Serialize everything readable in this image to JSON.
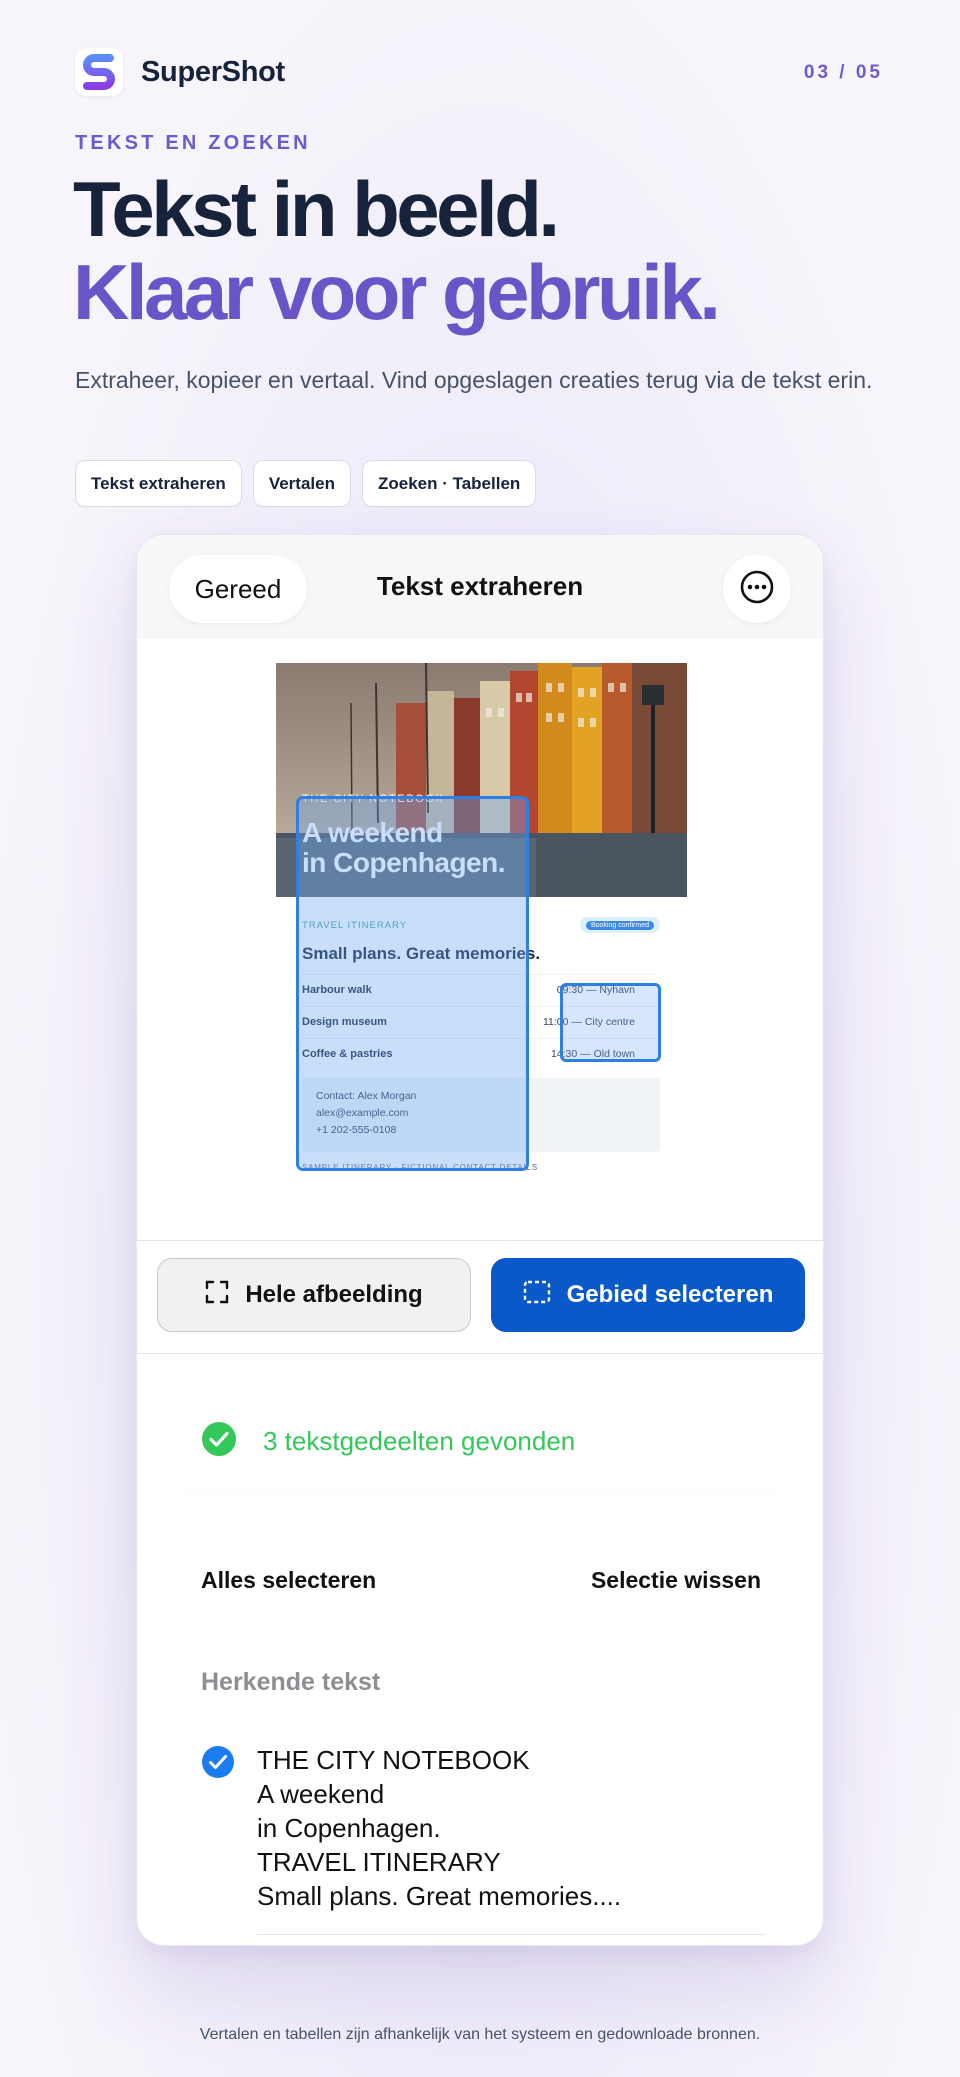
{
  "brand": {
    "name": "SuperShot",
    "logo_icon": "supershot-logo-icon"
  },
  "pager": "03 / 05",
  "hero": {
    "eyebrow": "TEKST EN ZOEKEN",
    "title_line1": "Tekst in beeld.",
    "title_line2": "Klaar voor gebruik.",
    "subtitle": "Extraheer, kopieer en vertaal. Vind opgeslagen creaties terug via de tekst erin."
  },
  "chips": [
    "Tekst extraheren",
    "Vertalen",
    "Zoeken · Tabellen"
  ],
  "app": {
    "done_label": "Gereed",
    "title": "Tekst extraheren",
    "more_icon": "ellipsis-circle-icon",
    "preview": {
      "eyebrow": "THE CITY NOTEBOOK",
      "title_line1": "A weekend",
      "title_line2": "in Copenhagen.",
      "kicker": "TRAVEL ITINERARY",
      "badge": "Booking confirmed",
      "heading": "Small plans. Great memories.",
      "rows": [
        {
          "name": "Harbour walk",
          "time": "09:30 — Nyhavn"
        },
        {
          "name": "Design museum",
          "time": "11:00 — City centre"
        },
        {
          "name": "Coffee & pastries",
          "time": "14:30 — Old town"
        }
      ],
      "contact": [
        "Contact: Alex Morgan",
        "alex@example.com",
        "+1 202-555-0108"
      ],
      "footer": "SAMPLE ITINERARY · FICTIONAL CONTACT DETAILS"
    },
    "modes": {
      "whole": "Hele afbeelding",
      "whole_icon": "viewfinder-icon",
      "area": "Gebied selecteren",
      "area_icon": "dashed-selection-icon",
      "active": "area"
    },
    "found": {
      "text": "3 tekstgedeelten gevonden",
      "icon": "checkmark-circle-icon",
      "color": "#34c759"
    },
    "actions": {
      "select_all": "Alles selecteren",
      "clear": "Selectie wissen"
    },
    "recognized": {
      "label": "Herkende tekst",
      "items": [
        {
          "checked": true,
          "lines": [
            "THE CITY NOTEBOOK",
            "A weekend",
            "in Copenhagen.",
            "TRAVEL ITINERARY",
            "Small plans. Great memories...."
          ]
        }
      ]
    }
  },
  "footnote": "Vertalen en tabellen zijn afhankelijk van het systeem en gedownloade bronnen.",
  "colors": {
    "accent": "#6a55c8",
    "primary_button": "#0a59c9",
    "success": "#34c759",
    "selection": "#2f7fe3"
  }
}
